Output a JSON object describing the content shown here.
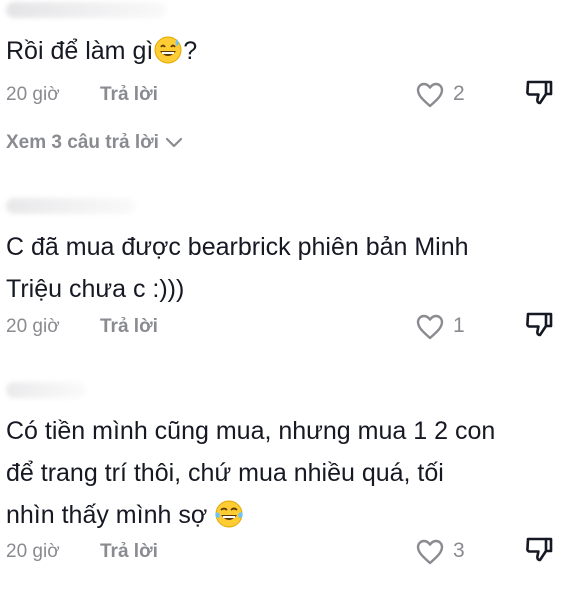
{
  "comments": [
    {
      "text_before": "Rồi để làm gì",
      "emoji": "grinning-sweat-emoji",
      "text_after": "?",
      "time": "20 giờ",
      "reply_label": "Trả lời",
      "likes": "2"
    },
    {
      "text_before": "C đã mua được bearbrick phiên bản Minh\nTriệu chưa c :)))",
      "emoji": "",
      "text_after": "",
      "time": "20 giờ",
      "reply_label": "Trả lời",
      "likes": "1"
    },
    {
      "text_before": "Có tiền mình cũng mua, nhưng mua 1 2 con\nđể trang trí thôi, chứ mua nhiều quá, tối\nnhìn thấy mình sợ ",
      "emoji": "tears-of-joy-emoji",
      "text_after": "",
      "time": "20 giờ",
      "reply_label": "Trả lời",
      "likes": "3"
    }
  ],
  "view_replies": {
    "label": "Xem 3 câu trả lời"
  },
  "icons": {
    "like": "heart-outline-icon",
    "dislike": "thumb-down-icon",
    "expand": "chevron-down-icon"
  },
  "colors": {
    "text": "#161823",
    "muted": "#8a8b91",
    "emoji": "#ffcc33"
  }
}
